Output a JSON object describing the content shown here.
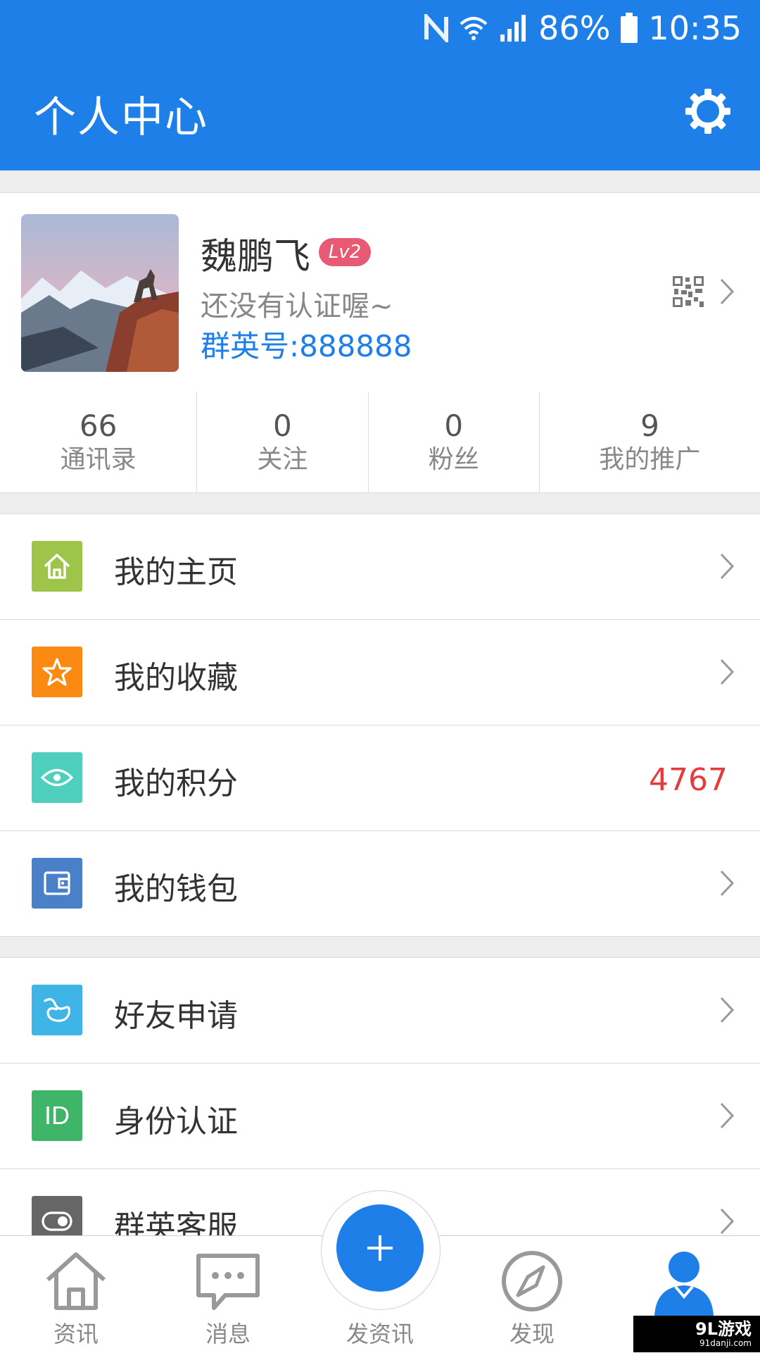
{
  "status_bar": {
    "battery": "86%",
    "time": "10:35"
  },
  "header": {
    "title": "个人中心"
  },
  "profile": {
    "name": "魏鹏飞",
    "level": "Lv2",
    "note": "还没有认证喔~",
    "id_text": "群英号:888888"
  },
  "stats": [
    {
      "value": "66",
      "label": "通讯录"
    },
    {
      "value": "0",
      "label": "关注"
    },
    {
      "value": "0",
      "label": "粉丝"
    },
    {
      "value": "9",
      "label": "我的推广"
    }
  ],
  "menu": {
    "homepage": "我的主页",
    "favorites": "我的收藏",
    "points": "我的积分",
    "points_value": "4767",
    "wallet": "我的钱包",
    "friend_requests": "好友申请",
    "identity": "身份认证",
    "identity_icon_text": "ID",
    "service": "群英客服"
  },
  "bottom_nav": {
    "news": "资讯",
    "messages": "消息",
    "post": "发资讯",
    "discover": "发现"
  },
  "watermark": {
    "brand": "9L游戏",
    "url": "91danji.com"
  },
  "colors": {
    "primary": "#1e7fe8",
    "home_icon": "#9ec44a",
    "fav_icon": "#fb8a12",
    "points_icon": "#4fcfbd",
    "wallet_icon": "#4a80c8",
    "friend_icon": "#3fb4e6",
    "identity_icon": "#3fb56a",
    "service_icon": "#666666",
    "points_value": "#e63b3b",
    "level_badge": "#e85a73"
  }
}
